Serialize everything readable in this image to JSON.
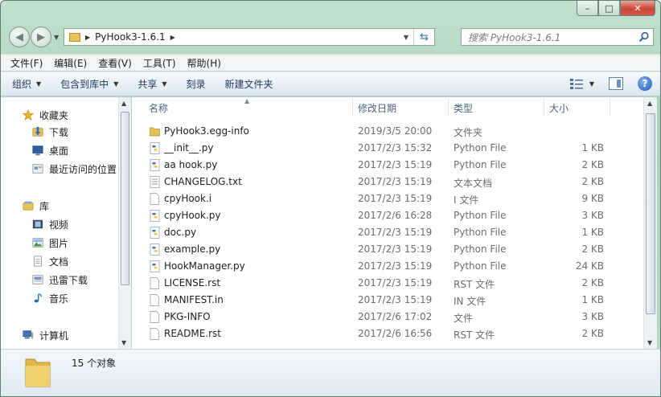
{
  "window": {
    "minimize_glyph": "–",
    "maximize_glyph": "□",
    "close_glyph": "✕"
  },
  "address": {
    "path": "PyHook3-1.6.1",
    "back_icon": "back-arrow-icon",
    "forward_icon": "forward-arrow-icon",
    "refresh_icon": "refresh-icon"
  },
  "search": {
    "placeholder": "搜索 PyHook3-1.6.1"
  },
  "menubar": [
    {
      "label": "文件(F)"
    },
    {
      "label": "编辑(E)"
    },
    {
      "label": "查看(V)"
    },
    {
      "label": "工具(T)"
    },
    {
      "label": "帮助(H)"
    }
  ],
  "toolbar": {
    "organize": "组织",
    "include_in_library": "包含到库中",
    "share": "共享",
    "burn": "刻录",
    "new_folder": "新建文件夹",
    "help_glyph": "?"
  },
  "navpane": {
    "favorites": "收藏夹",
    "downloads": "下载",
    "desktop": "桌面",
    "recent": "最近访问的位置",
    "libraries": "库",
    "videos": "视频",
    "pictures": "图片",
    "documents": "文档",
    "thunder": "迅雷下载",
    "music": "音乐",
    "computer": "计算机"
  },
  "columns": {
    "name": "名称",
    "date": "修改日期",
    "type": "类型",
    "size": "大小"
  },
  "files": [
    {
      "name": "PyHook3.egg-info",
      "date": "2019/3/5 20:00",
      "type": "文件夹",
      "size": "",
      "icon": "folder"
    },
    {
      "name": "__init__.py",
      "date": "2017/2/3 15:32",
      "type": "Python File",
      "size": "1 KB",
      "icon": "python"
    },
    {
      "name": "aa hook.py",
      "date": "2017/2/3 15:19",
      "type": "Python File",
      "size": "2 KB",
      "icon": "python"
    },
    {
      "name": "CHANGELOG.txt",
      "date": "2017/2/3 15:19",
      "type": "文本文档",
      "size": "2 KB",
      "icon": "text"
    },
    {
      "name": "cpyHook.i",
      "date": "2017/2/3 15:19",
      "type": "I 文件",
      "size": "9 KB",
      "icon": "blank"
    },
    {
      "name": "cpyHook.py",
      "date": "2017/2/6 16:28",
      "type": "Python File",
      "size": "3 KB",
      "icon": "python"
    },
    {
      "name": "doc.py",
      "date": "2017/2/3 15:19",
      "type": "Python File",
      "size": "1 KB",
      "icon": "python"
    },
    {
      "name": "example.py",
      "date": "2017/2/3 15:19",
      "type": "Python File",
      "size": "2 KB",
      "icon": "python"
    },
    {
      "name": "HookManager.py",
      "date": "2017/2/3 15:19",
      "type": "Python File",
      "size": "24 KB",
      "icon": "python"
    },
    {
      "name": "LICENSE.rst",
      "date": "2017/2/3 15:19",
      "type": "RST 文件",
      "size": "2 KB",
      "icon": "blank"
    },
    {
      "name": "MANIFEST.in",
      "date": "2017/2/3 15:19",
      "type": "IN 文件",
      "size": "1 KB",
      "icon": "blank"
    },
    {
      "name": "PKG-INFO",
      "date": "2017/2/6 17:02",
      "type": "文件",
      "size": "3 KB",
      "icon": "blank"
    },
    {
      "name": "README.rst",
      "date": "2017/2/6 16:56",
      "type": "RST 文件",
      "size": "2 KB",
      "icon": "blank"
    }
  ],
  "status": {
    "count": "15 个对象"
  },
  "colors": {
    "chrome": "#b7dcc4",
    "toolbar": "#dce7f1",
    "folder": "#e6c25a",
    "python_blue": "#3f73b5",
    "python_yellow": "#f2c640"
  }
}
